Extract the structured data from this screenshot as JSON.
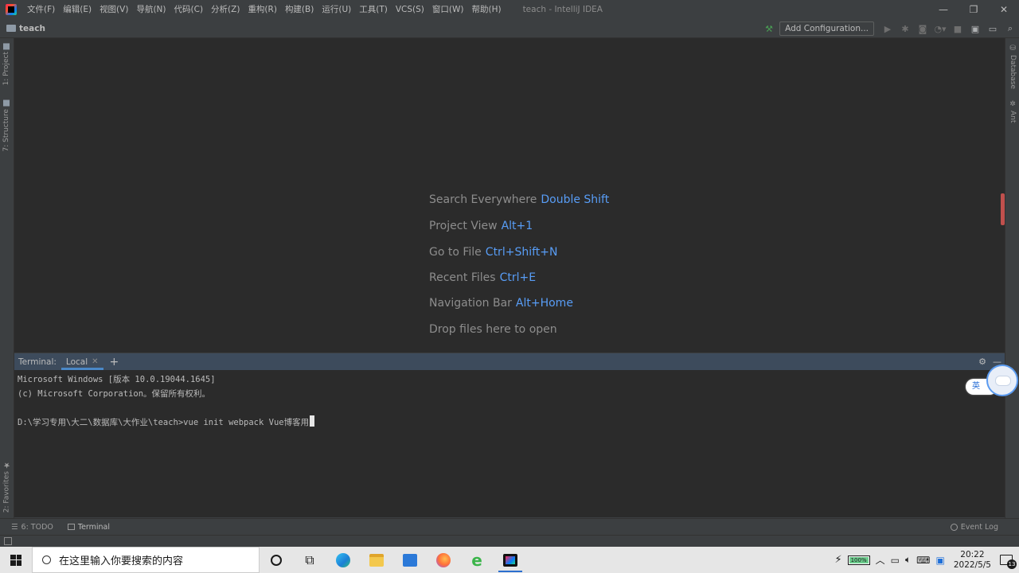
{
  "menu": [
    "文件(F)",
    "编辑(E)",
    "视图(V)",
    "导航(N)",
    "代码(C)",
    "分析(Z)",
    "重构(R)",
    "构建(B)",
    "运行(U)",
    "工具(T)",
    "VCS(S)",
    "窗口(W)",
    "帮助(H)"
  ],
  "window_title": "teach - IntelliJ IDEA",
  "window_controls": {
    "minimize": "—",
    "restore": "❐",
    "close": "✕"
  },
  "navbar": {
    "project": "teach",
    "add_config_label": "Add Configuration..."
  },
  "left_tabs": {
    "project": "1: Project",
    "structure": "7: Structure",
    "favorites": "2: Favorites"
  },
  "right_tabs": {
    "database": "Database",
    "ant": "Ant"
  },
  "hints": [
    {
      "label": "Search Everywhere",
      "key": "Double Shift"
    },
    {
      "label": "Project View",
      "key": "Alt+1"
    },
    {
      "label": "Go to File",
      "key": "Ctrl+Shift+N"
    },
    {
      "label": "Recent Files",
      "key": "Ctrl+E"
    },
    {
      "label": "Navigation Bar",
      "key": "Alt+Home"
    },
    {
      "label": "Drop files here to open",
      "key": ""
    }
  ],
  "terminal": {
    "title": "Terminal:",
    "tab_label": "Local",
    "lines": [
      "Microsoft Windows [版本 10.0.19044.1645]",
      "(c) Microsoft Corporation。保留所有权利。",
      "",
      "D:\\学习专用\\大二\\数据库\\大作业\\teach>vue init webpack Vue博客用"
    ]
  },
  "ime": {
    "label": "英"
  },
  "bottom_bar": {
    "todo": "6: TODO",
    "terminal": "Terminal",
    "event_log": "Event Log"
  },
  "taskbar": {
    "search_placeholder": "在这里输入你要搜索的内容",
    "battery": "100%",
    "time": "20:22",
    "date": "2022/5/5",
    "notification_count": "13"
  },
  "colors": {
    "accent": "#589df6",
    "terminal_tab_underline": "#4a88c7",
    "editor_bg": "#2b2b2b",
    "chrome_bg": "#3c3f41"
  }
}
